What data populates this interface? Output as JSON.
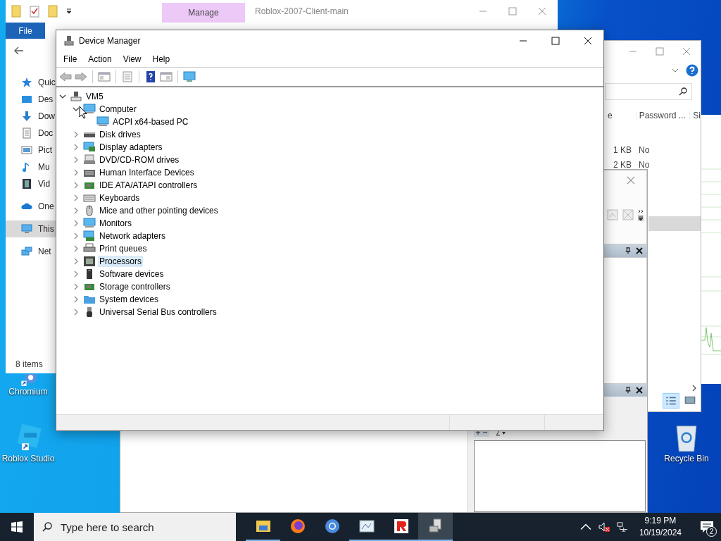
{
  "desktop_icons": [
    {
      "label": "Chromium",
      "kind": "chromium"
    },
    {
      "label": "Roblox Studio",
      "kind": "studio"
    },
    {
      "label": "Recycle Bin",
      "kind": "recycle"
    }
  ],
  "explorer": {
    "contextual_tab": "Manage",
    "title": "Roblox-2007-Client-main",
    "file_tab": "File",
    "nav_groups": [
      [
        {
          "label": "Quic",
          "kind": "star",
          "selected": false
        },
        {
          "label": "Des",
          "kind": "desktop",
          "selected": false
        },
        {
          "label": "Dow",
          "kind": "download",
          "selected": false
        },
        {
          "label": "Doc",
          "kind": "document",
          "selected": false
        },
        {
          "label": "Pict",
          "kind": "picture",
          "selected": false
        },
        {
          "label": "Mu",
          "kind": "music",
          "selected": false
        },
        {
          "label": "Vid",
          "kind": "video",
          "selected": false
        }
      ],
      [
        {
          "label": "One",
          "kind": "cloud",
          "selected": false
        }
      ],
      [
        {
          "label": "This",
          "kind": "pc",
          "selected": true
        }
      ],
      [
        {
          "label": "Net",
          "kind": "network",
          "selected": false
        }
      ]
    ],
    "status": "8 items"
  },
  "explorer_2": {
    "columns": [
      "e",
      "Password ...",
      "Si"
    ],
    "rows": [
      {
        "cells": [
          "1 KB",
          "No"
        ],
        "selected": false
      },
      {
        "cells": [
          "2 KB",
          "No"
        ],
        "selected": false
      },
      {
        "selected": true
      }
    ]
  },
  "device_manager": {
    "title": "Device Manager",
    "menu": [
      "File",
      "Action",
      "View",
      "Help"
    ],
    "tree": {
      "label": "VM5",
      "kind": "network-pc",
      "expanded": true,
      "selected": false,
      "children": [
        {
          "label": "Computer",
          "kind": "monitor",
          "expanded": true,
          "selected": false,
          "children": [
            {
              "label": "ACPI x64-based PC",
              "kind": "monitor",
              "selected": false
            }
          ]
        },
        {
          "label": "Disk drives",
          "kind": "disk",
          "expanded": false,
          "selected": false
        },
        {
          "label": "Display adapters",
          "kind": "display",
          "expanded": false,
          "selected": false
        },
        {
          "label": "DVD/CD-ROM drives",
          "kind": "dvd",
          "expanded": false,
          "selected": false
        },
        {
          "label": "Human Interface Devices",
          "kind": "hid",
          "expanded": false,
          "selected": false
        },
        {
          "label": "IDE ATA/ATAPI controllers",
          "kind": "board",
          "expanded": false,
          "selected": false
        },
        {
          "label": "Keyboards",
          "kind": "keyboard",
          "expanded": false,
          "selected": false
        },
        {
          "label": "Mice and other pointing devices",
          "kind": "mouse",
          "expanded": false,
          "selected": false
        },
        {
          "label": "Monitors",
          "kind": "monitor",
          "expanded": false,
          "selected": false
        },
        {
          "label": "Network adapters",
          "kind": "network",
          "expanded": false,
          "selected": false
        },
        {
          "label": "Print queues",
          "kind": "printer",
          "expanded": false,
          "selected": false
        },
        {
          "label": "Processors",
          "kind": "chip",
          "expanded": false,
          "selected": true
        },
        {
          "label": "Software devices",
          "kind": "tower",
          "expanded": false,
          "selected": false
        },
        {
          "label": "Storage controllers",
          "kind": "board",
          "expanded": false,
          "selected": false
        },
        {
          "label": "System devices",
          "kind": "folder",
          "expanded": false,
          "selected": false
        },
        {
          "label": "Universal Serial Bus controllers",
          "kind": "usb",
          "expanded": false,
          "selected": false
        }
      ]
    }
  },
  "taskbar": {
    "search_placeholder": "Type here to search",
    "apps": [
      {
        "kind": "files",
        "open": true,
        "selected": false
      },
      {
        "kind": "firefox",
        "open": false,
        "selected": false
      },
      {
        "kind": "chromium",
        "open": false,
        "selected": false
      },
      {
        "kind": "paint",
        "open": true,
        "selected": false
      },
      {
        "kind": "roblox",
        "open": true,
        "selected": false
      },
      {
        "kind": "device-manager",
        "open": true,
        "selected": true
      }
    ],
    "time": "9:19 PM",
    "date": "10/19/2024",
    "notifications": "2"
  }
}
